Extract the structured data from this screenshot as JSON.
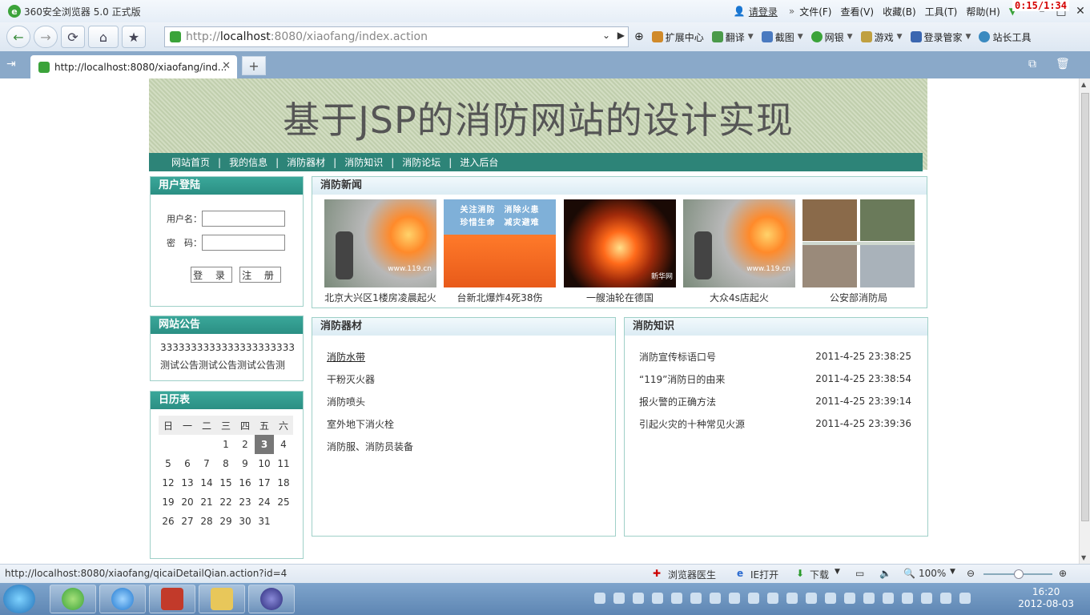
{
  "browser": {
    "title": "360安全浏览器 5.0 正式版",
    "login_link": "请登录",
    "menus": [
      "文件(F)",
      "查看(V)",
      "收藏(B)",
      "工具(T)",
      "帮助(H)"
    ],
    "timer": "0:15/1:34",
    "address": {
      "prefix": "http://",
      "host": "localhost",
      "rest": ":8080/xiaofang/index.action"
    },
    "toolbar": [
      "扩展中心",
      "翻译",
      "截图",
      "网银",
      "游戏",
      "登录管家",
      "站长工具"
    ],
    "tab_title": "http://localhost:8080/xiaofang/ind..."
  },
  "page": {
    "site_title": "基于JSP的消防网站的设计实现",
    "nav": [
      "网站首页",
      "我的信息",
      "消防器材",
      "消防知识",
      "消防论坛",
      "进入后台"
    ],
    "login": {
      "heading": "用户登陆",
      "username_label": "用户名：",
      "password_label": "密　码：",
      "username_value": "",
      "password_value": "",
      "login_button": "登 录",
      "register_button": "注 册"
    },
    "notice": {
      "heading": "网站公告",
      "lines": [
        "3333333333333333333333",
        "测试公告测试公告测试公告测"
      ]
    },
    "calendar": {
      "heading": "日历表",
      "weekdays": [
        "日",
        "一",
        "二",
        "三",
        "四",
        "五",
        "六"
      ],
      "weeks": [
        [
          "",
          "",
          "",
          "1",
          "2",
          "3",
          "4"
        ],
        [
          "5",
          "6",
          "7",
          "8",
          "9",
          "10",
          "11"
        ],
        [
          "12",
          "13",
          "14",
          "15",
          "16",
          "17",
          "18"
        ],
        [
          "19",
          "20",
          "21",
          "22",
          "23",
          "24",
          "25"
        ],
        [
          "26",
          "27",
          "28",
          "29",
          "30",
          "31",
          ""
        ]
      ],
      "today": "3"
    },
    "news": {
      "heading": "消防新闻",
      "items": [
        {
          "caption": "北京大兴区1楼房凌晨起火",
          "watermark": "www.119.cn"
        },
        {
          "caption": "台新北爆炸4死38伤",
          "banner_text_1": "关注消防　消除火患",
          "banner_text_2": "珍惜生命　减灾避难"
        },
        {
          "caption": "一艘油轮在德国",
          "watermark": "新华网"
        },
        {
          "caption": "大众4s店起火",
          "watermark": "www.119.cn"
        },
        {
          "caption": "公安部消防局"
        }
      ]
    },
    "equipment": {
      "heading": "消防器材",
      "items": [
        "消防水带",
        "干粉灭火器",
        "消防喷头",
        "室外地下消火栓",
        "消防服、消防员装备"
      ]
    },
    "knowledge": {
      "heading": "消防知识",
      "items": [
        {
          "title": "消防宣传标语口号",
          "date": "2011-4-25 23:38:25"
        },
        {
          "title": "“119”消防日的由来",
          "date": "2011-4-25 23:38:54"
        },
        {
          "title": "报火警的正确方法",
          "date": "2011-4-25 23:39:14"
        },
        {
          "title": "引起火灾的十种常见火源",
          "date": "2011-4-25 23:39:36"
        }
      ]
    }
  },
  "statusbar": {
    "url": "http://localhost:8080/xiaofang/qicaiDetailQian.action?id=4",
    "doctor": "浏览器医生",
    "ie_open": "IE打开",
    "download": "下载",
    "zoom": "100%"
  },
  "taskbar": {
    "time": "16:20",
    "date": "2012-08-03"
  }
}
